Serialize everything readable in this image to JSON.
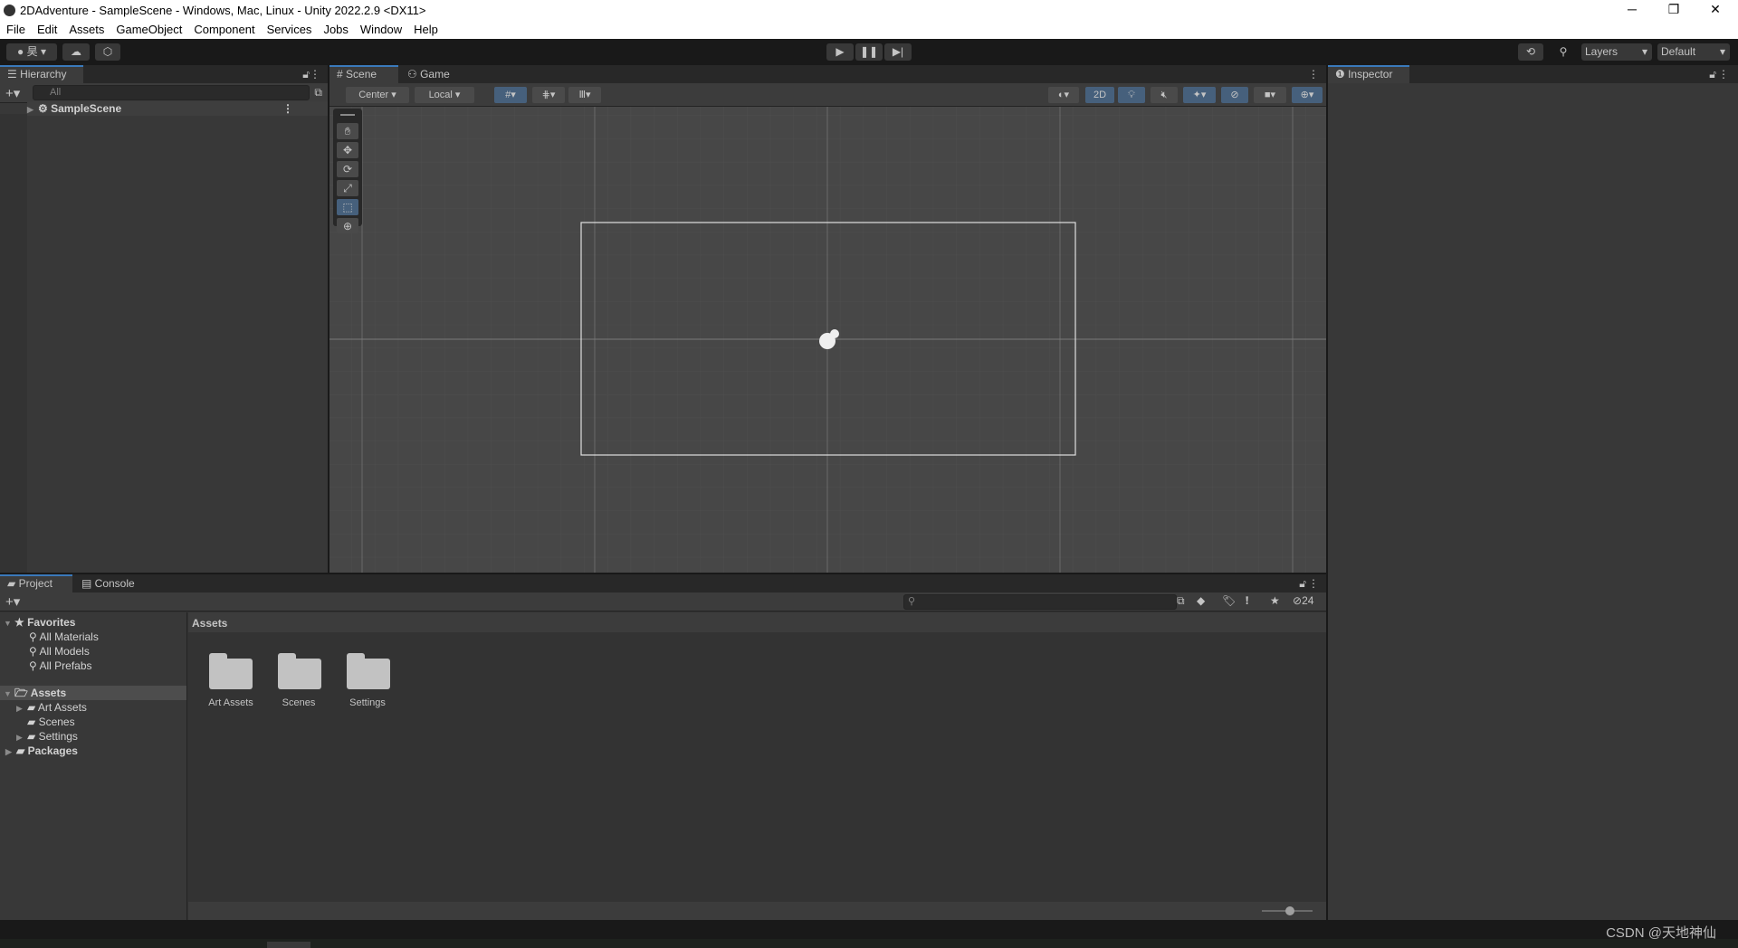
{
  "window": {
    "title": "2DAdventure - SampleScene - Windows, Mac, Linux - Unity 2022.2.9 <DX11>",
    "minimize": "─",
    "maximize": "❐",
    "close": "✕"
  },
  "menu": [
    "File",
    "Edit",
    "Assets",
    "GameObject",
    "Component",
    "Services",
    "Jobs",
    "Window",
    "Help"
  ],
  "toolbar": {
    "account": "昊",
    "layers": "Layers",
    "layout": "Default"
  },
  "hierarchy": {
    "tab": "Hierarchy",
    "search_placeholder": "All",
    "scene": "SampleScene"
  },
  "scene": {
    "tabs": [
      "Scene",
      "Game"
    ],
    "pivot": "Center",
    "space": "Local",
    "mode_2d": "2D"
  },
  "inspector": {
    "tab": "Inspector"
  },
  "project": {
    "tabs": [
      "Project",
      "Console"
    ],
    "hidden_count": "24",
    "favorites": {
      "label": "Favorites",
      "items": [
        "All Materials",
        "All Models",
        "All Prefabs"
      ]
    },
    "assets": {
      "label": "Assets",
      "items": [
        "Art Assets",
        "Scenes",
        "Settings"
      ]
    },
    "packages": "Packages",
    "breadcrumb": "Assets",
    "grid": [
      "Art Assets",
      "Scenes",
      "Settings"
    ]
  },
  "watermark": "CSDN @天地神仙",
  "accent": "#3a79bb"
}
